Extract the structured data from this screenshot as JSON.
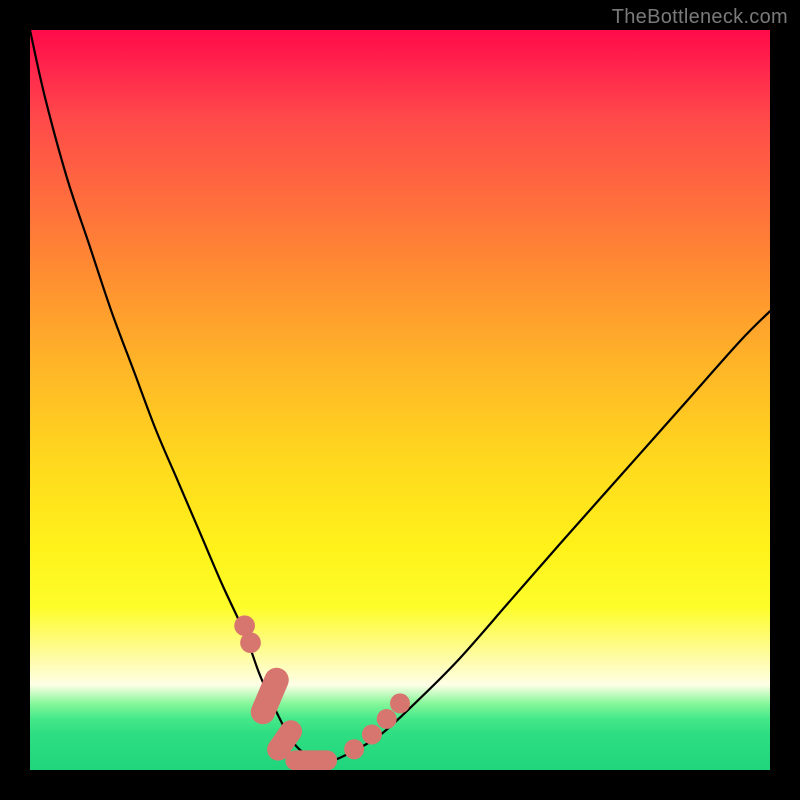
{
  "watermark": {
    "text": "TheBottleneck.com"
  },
  "colors": {
    "page_bg": "#000000",
    "curve_stroke": "#000000",
    "marker_fill": "#d7766f",
    "marker_stroke": "#b85a55"
  },
  "chart_data": {
    "type": "line",
    "title": "",
    "xlabel": "",
    "ylabel": "",
    "xlim": [
      0,
      100
    ],
    "ylim": [
      0,
      100
    ],
    "grid": false,
    "legend": false,
    "note": "Axes are unitless; y is inverted in SVG coords so higher value = higher on screen.",
    "series": [
      {
        "name": "bottleneck-curve",
        "x": [
          0,
          2,
          5,
          8,
          11,
          14,
          17,
          20,
          23,
          26,
          29,
          31,
          33,
          34.5,
          36,
          38,
          40,
          42,
          47,
          52,
          58,
          65,
          72,
          80,
          88,
          96,
          100
        ],
        "y": [
          100,
          91,
          80,
          71,
          62,
          54,
          46,
          39,
          32,
          25,
          18.5,
          13,
          8.5,
          5.5,
          3.2,
          1.7,
          1.2,
          1.7,
          4.5,
          9,
          15,
          23,
          31,
          40,
          49,
          58,
          62
        ]
      }
    ],
    "markers": [
      {
        "shape": "circle",
        "x": 29.0,
        "y": 19.5,
        "r": 1.4
      },
      {
        "shape": "circle",
        "x": 29.8,
        "y": 17.2,
        "r": 1.4
      },
      {
        "shape": "round-rect",
        "x": 32.4,
        "y": 10.0,
        "w": 3.3,
        "h": 8.0,
        "rot": 23
      },
      {
        "shape": "round-rect",
        "x": 34.4,
        "y": 4.0,
        "w": 3.0,
        "h": 6.0,
        "rot": 35
      },
      {
        "shape": "round-rect",
        "x": 38.0,
        "y": 1.3,
        "w": 7.0,
        "h": 2.7,
        "rot": 0
      },
      {
        "shape": "circle",
        "x": 43.8,
        "y": 2.8,
        "r": 1.35
      },
      {
        "shape": "circle",
        "x": 46.2,
        "y": 4.8,
        "r": 1.35
      },
      {
        "shape": "circle",
        "x": 48.2,
        "y": 6.9,
        "r": 1.35
      },
      {
        "shape": "circle",
        "x": 50.0,
        "y": 9.0,
        "r": 1.35
      }
    ]
  }
}
